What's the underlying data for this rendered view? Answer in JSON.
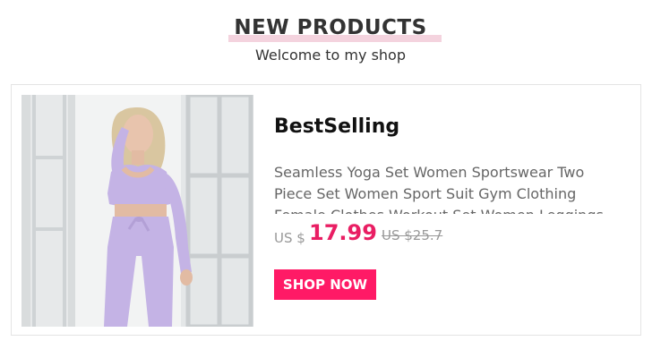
{
  "header": {
    "title": "NEW PRODUCTS",
    "subtitle": "Welcome to my shop"
  },
  "product": {
    "badge": "BestSelling",
    "description": "Seamless Yoga Set Women Sportswear Two Piece Set Women Sport Suit Gym Clothing Female Clothes Workout Set Women Leggings",
    "currency": "US $",
    "price": "17.99",
    "old_price": "US $25.7",
    "button_label": "SHOP NOW",
    "image_icon": "product-photo"
  },
  "colors": {
    "accent": "#ff1a66",
    "price": "#e91e63",
    "title_highlight": "#f4d3de",
    "outfit": "#c4b3e5"
  }
}
